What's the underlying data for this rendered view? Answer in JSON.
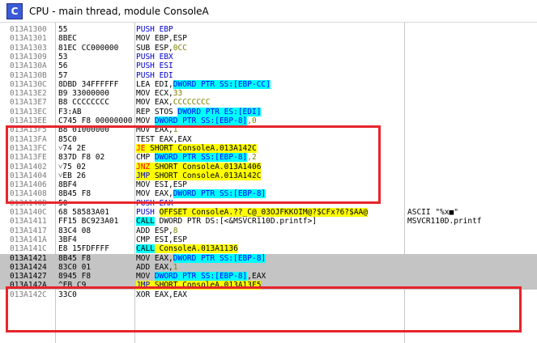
{
  "window": {
    "icon_letter": "C",
    "title": "CPU - main thread, module ConsoleA"
  },
  "rows": [
    {
      "addr": "013A1300",
      "bytes": "55",
      "instr": [
        {
          "t": "PUSH EBP",
          "s": "blue"
        }
      ],
      "comment": ""
    },
    {
      "addr": "013A1301",
      "bytes": "8BEC",
      "instr": [
        {
          "t": "MOV EBP,ESP",
          "s": ""
        }
      ],
      "comment": ""
    },
    {
      "addr": "013A1303",
      "bytes": "81EC CC000000",
      "instr": [
        {
          "t": "SUB ESP,",
          "s": ""
        },
        {
          "t": "0CC",
          "s": "olive"
        }
      ],
      "comment": ""
    },
    {
      "addr": "013A1309",
      "bytes": "53",
      "instr": [
        {
          "t": "PUSH EBX",
          "s": "blue"
        }
      ],
      "comment": ""
    },
    {
      "addr": "013A130A",
      "bytes": "56",
      "instr": [
        {
          "t": "PUSH ESI",
          "s": "blue"
        }
      ],
      "comment": ""
    },
    {
      "addr": "013A130B",
      "bytes": "57",
      "instr": [
        {
          "t": "PUSH EDI",
          "s": "blue"
        }
      ],
      "comment": ""
    },
    {
      "addr": "013A130C",
      "bytes": "8DBD 34FFFFFF",
      "instr": [
        {
          "t": "LEA EDI,",
          "s": ""
        },
        {
          "t": "DWORD PTR SS:[EBP-CC]",
          "s": "cyan"
        }
      ],
      "comment": ""
    },
    {
      "addr": "013A13E2",
      "bytes": "B9 33000000",
      "instr": [
        {
          "t": "MOV ECX,",
          "s": ""
        },
        {
          "t": "33",
          "s": "olive"
        }
      ],
      "comment": ""
    },
    {
      "addr": "013A13E7",
      "bytes": "B8 CCCCCCCC",
      "instr": [
        {
          "t": "MOV EAX,",
          "s": ""
        },
        {
          "t": "CCCCCCCC",
          "s": "olive"
        }
      ],
      "comment": ""
    },
    {
      "addr": "013A13EC",
      "bytes": "F3:AB",
      "instr": [
        {
          "t": "REP STOS ",
          "s": ""
        },
        {
          "t": "DWORD PTR ES:[EDI]",
          "s": "cyan"
        }
      ],
      "comment": ""
    },
    {
      "addr": "013A13EE",
      "bytes": "C745 F8 00000000",
      "instr": [
        {
          "t": "MOV ",
          "s": ""
        },
        {
          "t": "DWORD PTR SS:[EBP-8]",
          "s": "cyan"
        },
        {
          "t": ",0",
          "s": "olive"
        }
      ],
      "comment": ""
    },
    {
      "addr": "013A13F5",
      "bytes": "B8 01000000",
      "instr": [
        {
          "t": "MOV EAX,",
          "s": ""
        },
        {
          "t": "1",
          "s": "olive"
        }
      ],
      "comment": ""
    },
    {
      "addr": "013A13FA",
      "bytes": "85C0",
      "instr": [
        {
          "t": "TEST EAX,EAX",
          "s": ""
        }
      ],
      "comment": ""
    },
    {
      "addr": "013A13FC",
      "bytes": "˅74 2E",
      "instr": [
        {
          "t": "JE",
          "s": "red"
        },
        {
          "t": " SHORT ConsoleA.013A142C",
          "s": "yellow"
        }
      ],
      "comment": ""
    },
    {
      "addr": "013A13FE",
      "bytes": "837D F8 02",
      "instr": [
        {
          "t": "CMP ",
          "s": ""
        },
        {
          "t": "DWORD PTR SS:[EBP-8]",
          "s": "cyan"
        },
        {
          "t": ",2",
          "s": "olive"
        }
      ],
      "comment": ""
    },
    {
      "addr": "013A1402",
      "bytes": "˅75 02",
      "instr": [
        {
          "t": "JNZ",
          "s": "red"
        },
        {
          "t": " SHORT ConsoleA.013A1406",
          "s": "yellow"
        }
      ],
      "comment": ""
    },
    {
      "addr": "013A1404",
      "bytes": "˅EB 26",
      "instr": [
        {
          "t": "JMP",
          "s": "blueyellow"
        },
        {
          "t": " SHORT ConsoleA.013A142C",
          "s": "yellow"
        }
      ],
      "comment": ""
    },
    {
      "addr": "013A1406",
      "bytes": "8BF4",
      "instr": [
        {
          "t": "MOV ESI,ESP",
          "s": ""
        }
      ],
      "comment": ""
    },
    {
      "addr": "013A1408",
      "bytes": "8B45 F8",
      "instr": [
        {
          "t": "MOV EAX,",
          "s": ""
        },
        {
          "t": "DWORD PTR SS:[EBP-8]",
          "s": "cyan"
        }
      ],
      "comment": ""
    },
    {
      "addr": "013A140B",
      "bytes": "50",
      "instr": [
        {
          "t": "PUSH EAX",
          "s": "blue"
        }
      ],
      "comment": ""
    },
    {
      "addr": "013A140C",
      "bytes": "68 58583A01",
      "instr": [
        {
          "t": "PUSH ",
          "s": "blue"
        },
        {
          "t": "OFFSET ConsoleA.??_C@_03OJFKKOIM@?$CFx?6?$AA@",
          "s": "yellow"
        }
      ],
      "comment": "ASCII \"%x■\""
    },
    {
      "addr": "013A1411",
      "bytes": "FF15 BC923A01",
      "instr": [
        {
          "t": "CALL",
          "s": "cyancall"
        },
        {
          "t": " DWORD PTR DS:[<&MSVCR110D.printf>]",
          "s": ""
        }
      ],
      "comment": "MSVCR110D.printf"
    },
    {
      "addr": "013A1417",
      "bytes": "83C4 08",
      "instr": [
        {
          "t": "ADD ESP,",
          "s": ""
        },
        {
          "t": "8",
          "s": "olive"
        }
      ],
      "comment": ""
    },
    {
      "addr": "013A141A",
      "bytes": "3BF4",
      "instr": [
        {
          "t": "CMP ESI,ESP",
          "s": ""
        }
      ],
      "comment": ""
    },
    {
      "addr": "013A141C",
      "bytes": "E8 15FDFFFF",
      "instr": [
        {
          "t": "CALL",
          "s": "cyancall"
        },
        {
          "t": " ConsoleA.013A1136",
          "s": "yellow"
        }
      ],
      "comment": ""
    },
    {
      "addr": "013A1421",
      "bytes": "8B45 F8",
      "instr": [
        {
          "t": "MOV EAX,",
          "s": ""
        },
        {
          "t": "DWORD PTR SS:[EBP-8]",
          "s": "cyan"
        }
      ],
      "comment": "",
      "gray": true
    },
    {
      "addr": "013A1424",
      "bytes": "83C0 01",
      "instr": [
        {
          "t": "ADD EAX,",
          "s": ""
        },
        {
          "t": "1",
          "s": "olive"
        }
      ],
      "comment": "",
      "gray": true
    },
    {
      "addr": "013A1427",
      "bytes": "8945 F8",
      "instr": [
        {
          "t": "MOV ",
          "s": ""
        },
        {
          "t": "DWORD PTR SS:[EBP-8]",
          "s": "cyan"
        },
        {
          "t": ",EAX",
          "s": ""
        }
      ],
      "comment": "",
      "gray": true
    },
    {
      "addr": "013A142A",
      "bytes": "^EB C9",
      "instr": [
        {
          "t": "JMP",
          "s": "blueyellow"
        },
        {
          "t": " SHORT ConsoleA.013A13F5",
          "s": "yellow"
        }
      ],
      "comment": "",
      "gray": true
    },
    {
      "addr": "013A142C",
      "bytes": "33C0",
      "instr": [
        {
          "t": "XOR EAX,EAX",
          "s": ""
        }
      ],
      "comment": ""
    }
  ],
  "colors": {
    "highlight_box": "#e8242b",
    "address_gray": "#7d7d7d",
    "selected_band": "#c4c4c4",
    "operand_cyan": "#00ffff",
    "jump_yellow": "#ffff00"
  }
}
